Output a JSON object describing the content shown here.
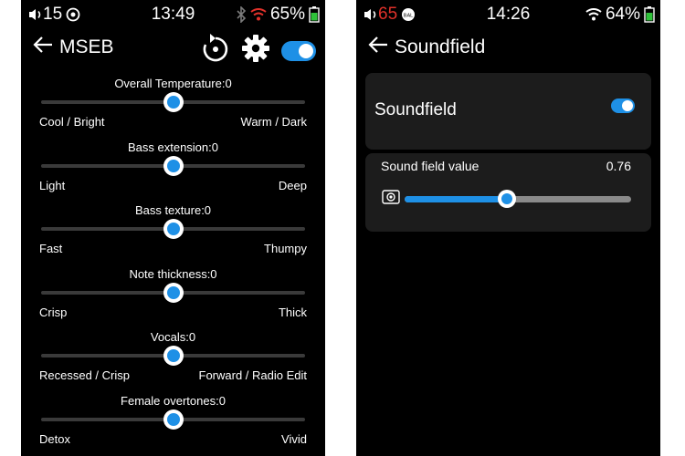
{
  "left": {
    "status": {
      "volume": "15",
      "time": "13:49",
      "battery": "65%"
    },
    "header": {
      "title": "MSEB"
    },
    "eq": [
      {
        "title": "Overall Temperature:0",
        "min": "Cool / Bright",
        "max": "Warm / Dark",
        "value": 0,
        "range": [
          -20,
          20
        ]
      },
      {
        "title": "Bass extension:0",
        "min": "Light",
        "max": "Deep",
        "value": 0,
        "range": [
          -20,
          20
        ]
      },
      {
        "title": "Bass texture:0",
        "min": "Fast",
        "max": "Thumpy",
        "value": 0,
        "range": [
          -20,
          20
        ]
      },
      {
        "title": "Note thickness:0",
        "min": "Crisp",
        "max": "Thick",
        "value": 0,
        "range": [
          -20,
          20
        ]
      },
      {
        "title": "Vocals:0",
        "min": "Recessed / Crisp",
        "max": "Forward / Radio Edit",
        "value": 0,
        "range": [
          -20,
          20
        ]
      },
      {
        "title": "Female overtones:0",
        "min": "Detox",
        "max": "Vivid",
        "value": 0,
        "range": [
          -20,
          20
        ]
      }
    ],
    "toggle_on": true
  },
  "right": {
    "status": {
      "volume": "65",
      "badge": "BAL",
      "time": "14:26",
      "battery": "64%"
    },
    "header": {
      "title": "Soundfield"
    },
    "card": {
      "label": "Soundfield",
      "on": true
    },
    "slider": {
      "label": "Sound field value",
      "value": "0.76",
      "fraction": 0.45
    }
  },
  "colors": {
    "accent": "#1e90e6",
    "volume_red": "#e0312a",
    "battery_green": "#2fc23a"
  }
}
